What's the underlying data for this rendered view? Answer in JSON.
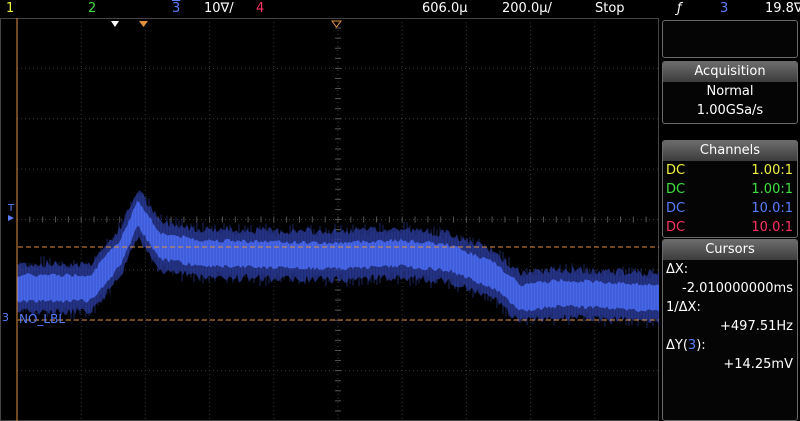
{
  "topbar": {
    "ch1": "1",
    "ch2": "2",
    "ch3_icon": "3",
    "ch3_scale": "10∇/",
    "ch4": "4",
    "time_position": "606.0µ",
    "time_scale": "200.0µ/",
    "run_state": "Stop",
    "trigger_icon": "trigger-edge-icon",
    "trigger_glyph": "ƒ",
    "trigger_source": "3",
    "trigger_level": "19.8∇"
  },
  "screen": {
    "channel_label": "NO_LBL",
    "trigger_marker": "T",
    "ch3_marker": "3"
  },
  "acquisition": {
    "title": "Acquisition",
    "mode": "Normal",
    "rate": "1.00GSa/s"
  },
  "channels": {
    "title": "Channels",
    "items": [
      {
        "coupling": "DC",
        "probe": "1.00:1",
        "color": "#f0f040"
      },
      {
        "coupling": "DC",
        "probe": "1.00:1",
        "color": "#40e040"
      },
      {
        "coupling": "DC",
        "probe": "10.0:1",
        "color": "#5a7cff"
      },
      {
        "coupling": "DC",
        "probe": "10.0:1",
        "color": "#ff3060"
      }
    ]
  },
  "cursors": {
    "title": "Cursors",
    "dx_label": "ΔX:",
    "dx_value": "-2.010000000ms",
    "inv_dx_label": "1/ΔX:",
    "inv_dx_value": "+497.51Hz",
    "dy_label_prefix": "ΔY(",
    "dy_label_channel": "3",
    "dy_label_suffix": "):",
    "dy_value": "+14.25mV"
  },
  "colors": {
    "ch1": "#f0f040",
    "ch2": "#40e040",
    "ch3": "#4a6cf0",
    "ch4": "#ff3060",
    "cursor": "#e09040",
    "grid": "#3a3a3a"
  }
}
